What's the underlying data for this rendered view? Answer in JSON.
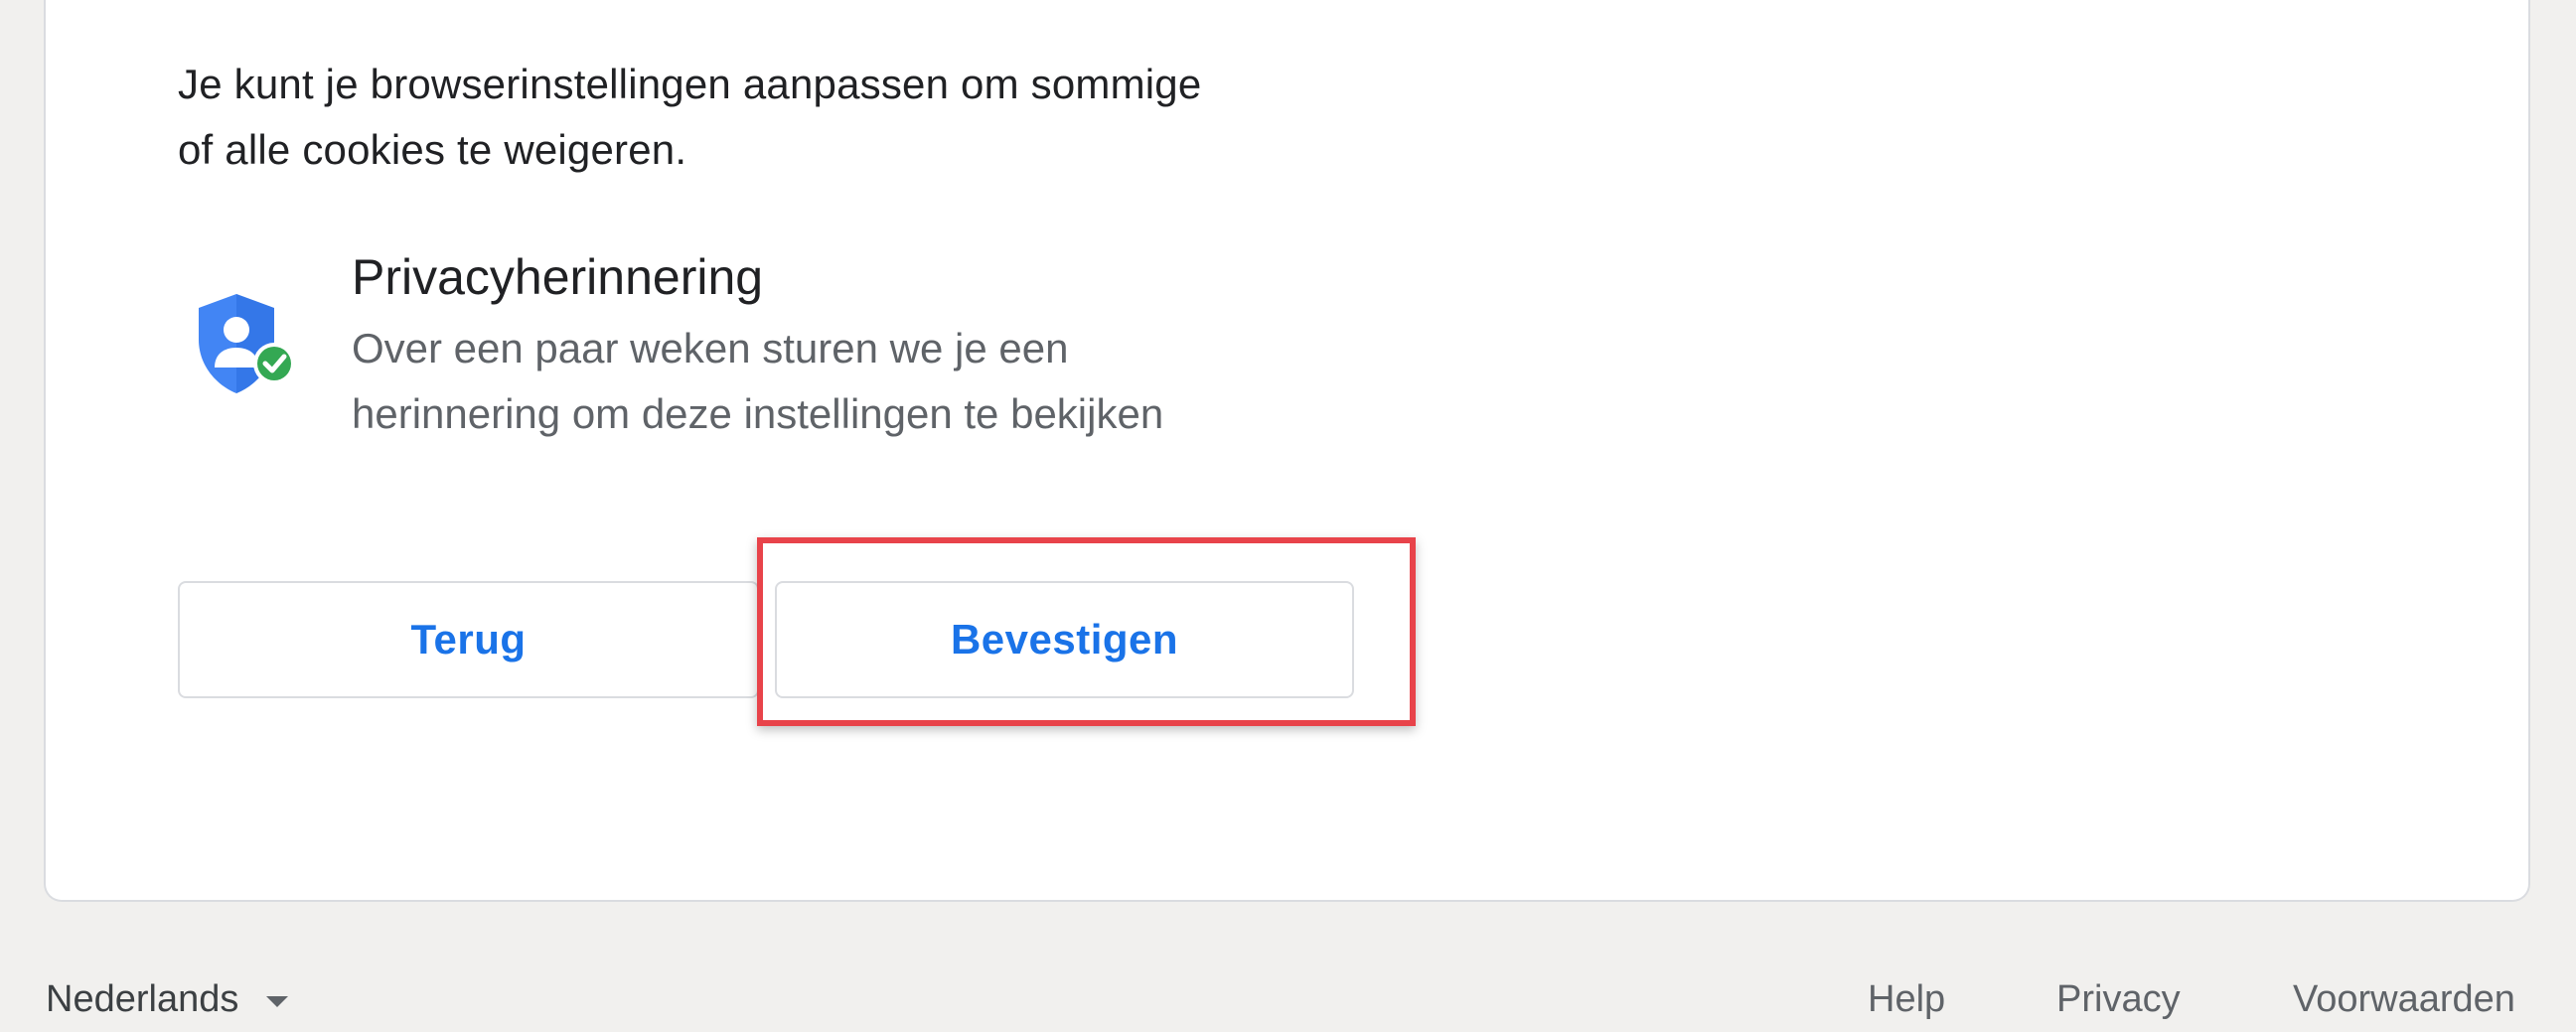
{
  "intro": {
    "line1": "Je kunt je browserinstellingen aanpassen om sommige",
    "line2": "of alle cookies te weigeren."
  },
  "reminder": {
    "icon": "privacy-shield-check-icon",
    "title": "Privacyherinnering",
    "desc_line1": "Over een paar weken sturen we je een",
    "desc_line2": "herinnering om deze instellingen te bekijken"
  },
  "buttons": {
    "back_label": "Terug",
    "confirm_label": "Bevestigen"
  },
  "footer": {
    "language": "Nederlands",
    "help": "Help",
    "privacy": "Privacy",
    "terms": "Voorwaarden"
  },
  "colors": {
    "accent": "#1a73e8",
    "shield": "#4285f4",
    "check": "#34a853",
    "highlight": "#e8434a"
  }
}
